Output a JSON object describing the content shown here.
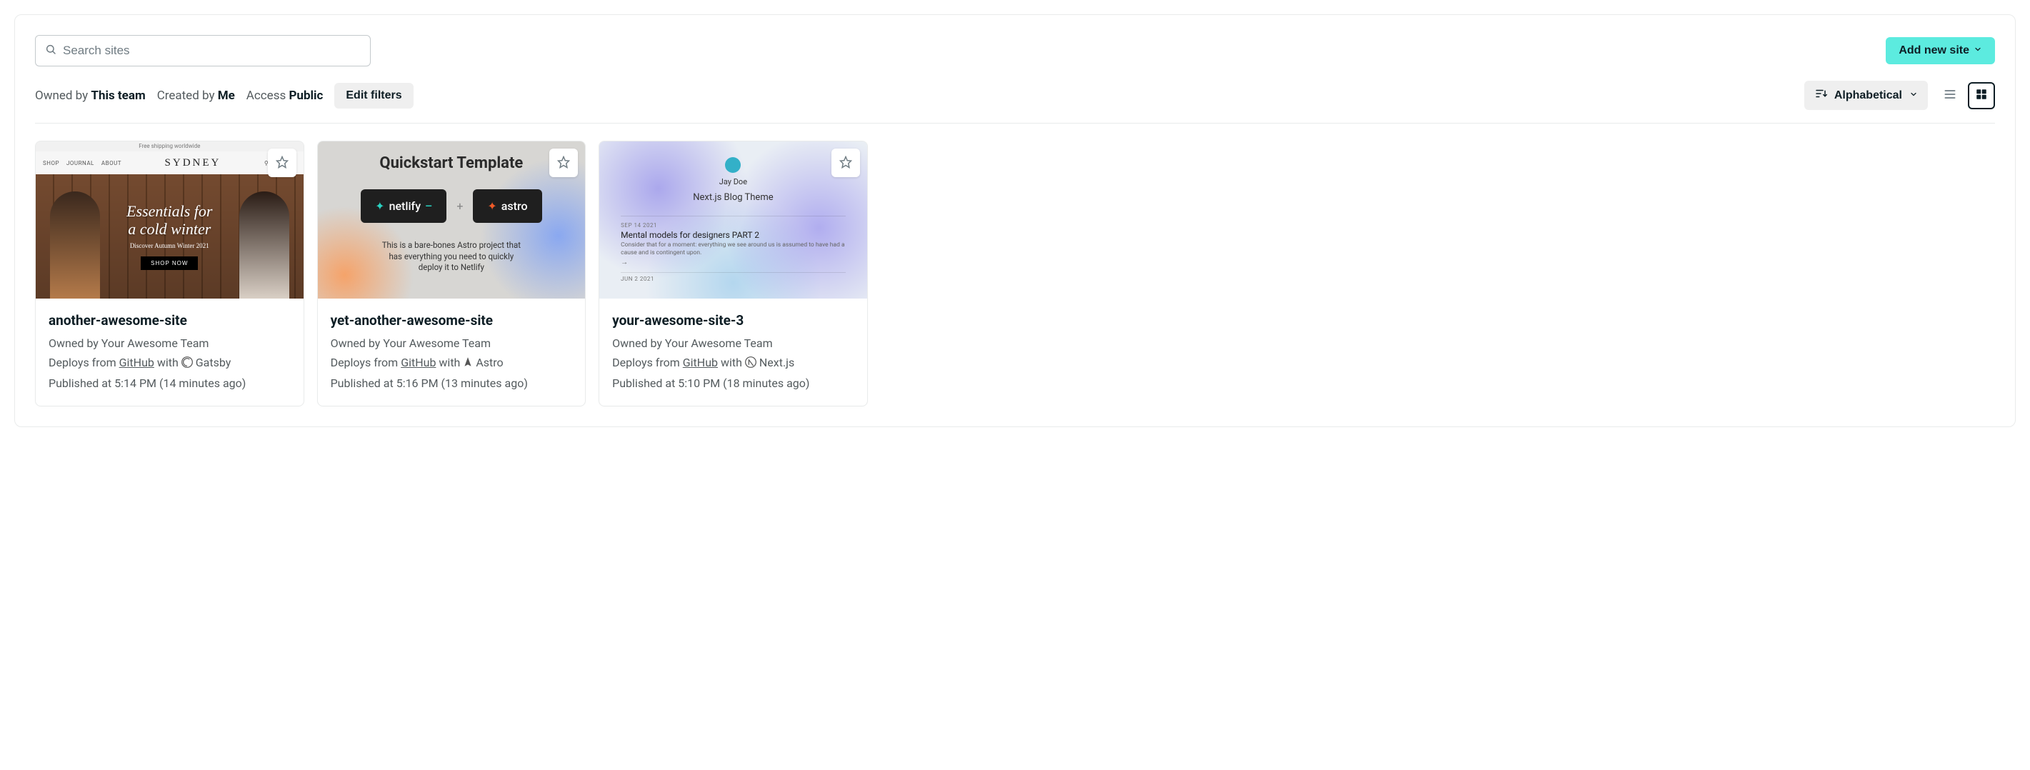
{
  "search": {
    "placeholder": "Search sites"
  },
  "add_button": {
    "label": "Add new site"
  },
  "filters": {
    "owned_prefix": "Owned by ",
    "owned_value": "This team",
    "created_prefix": "Created by ",
    "created_value": "Me",
    "access_prefix": "Access ",
    "access_value": "Public",
    "edit_label": "Edit filters"
  },
  "sort": {
    "label": "Alphabetical"
  },
  "cards": [
    {
      "title": "another-awesome-site",
      "owned_prefix": "Owned by ",
      "owner": "Your Awesome Team",
      "deploy_prefix": "Deploys from ",
      "source": "GitHub",
      "with": " with ",
      "framework": "Gatsby",
      "published": "Published at 5:14 PM (14 minutes ago)",
      "thumb": {
        "banner": "Free shipping worldwide",
        "nav1": "SHOP",
        "nav2": "JOURNAL",
        "nav3": "ABOUT",
        "logo": "SYDNEY",
        "h1a": "Essentials for",
        "h1b": "a cold winter",
        "sub": "Discover Autumn Winter 2021",
        "cta": "SHOP NOW"
      }
    },
    {
      "title": "yet-another-awesome-site",
      "owned_prefix": "Owned by ",
      "owner": "Your Awesome Team",
      "deploy_prefix": "Deploys from ",
      "source": "GitHub",
      "with": " with ",
      "framework": "Astro",
      "published": "Published at 5:16 PM (13 minutes ago)",
      "thumb": {
        "title": "Quickstart Template",
        "logo1": "netlify",
        "logo2": "astro",
        "desc": "This is a bare-bones Astro project that has everything you need to quickly deploy it to Netlify"
      }
    },
    {
      "title": "your-awesome-site-3",
      "owned_prefix": "Owned by ",
      "owner": "Your Awesome Team",
      "deploy_prefix": "Deploys from ",
      "source": "GitHub",
      "with": " with ",
      "framework": "Next.js",
      "published": "Published at 5:10 PM (18 minutes ago)",
      "thumb": {
        "name": "Jay Doe",
        "blog_title": "Next.js Blog Theme",
        "post_date": "SEP 14 2021",
        "post_title": "Mental models for designers PART 2",
        "post_desc": "Consider that for a moment: everything we see around us is assumed to have had a cause and is contingent upon.",
        "next_date": "JUN 2 2021"
      }
    }
  ]
}
